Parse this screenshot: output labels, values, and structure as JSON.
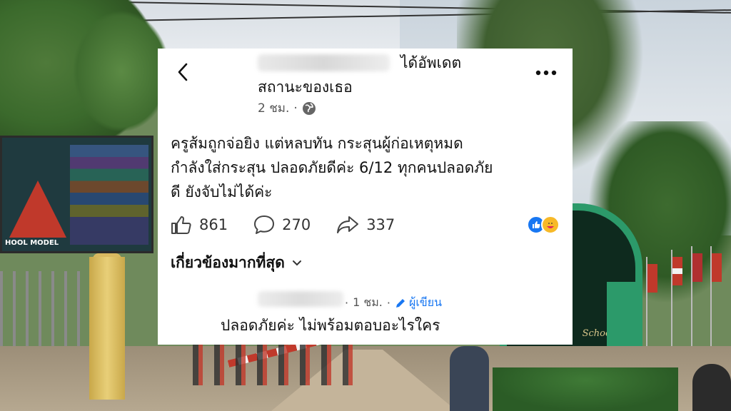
{
  "post": {
    "name_suffix": "ได้อัพเดต",
    "status_line": "สถานะของเธอ",
    "time": "2 ชม.",
    "dot": "·",
    "text": "ครูส้มถูกจ่อยิง  แต่หลบทัน กระสุนผู้ก่อเหตุหมด\nกำลังใส่กระสุน ปลอดภัยดีค่ะ 6/12 ทุกคนปลอดภัย\nดี  ยังจับไม่ได้ค่ะ",
    "likes": "861",
    "comments": "270",
    "shares": "337"
  },
  "sort": {
    "label": "เกี่ยวข้องมากที่สุด"
  },
  "comment": {
    "time": "1 ชม.",
    "dot": "·",
    "author_badge": "ผู้เขียน",
    "text": "ปลอดภัยค่ะ  ไม่พร้อมตอบอะไรใคร"
  },
  "background": {
    "school_word": "School",
    "billboard_caption": "HOOL MODEL"
  },
  "colors": {
    "facebook_blue": "#1877f2",
    "care_yellow": "#f7b928"
  },
  "icons": {
    "back": "chevron-left-icon",
    "more": "more-horizontal-icon",
    "audience": "globe-icon",
    "like": "thumbs-up-icon",
    "comment": "comment-bubble-icon",
    "share": "share-arrow-icon",
    "sort": "chevron-down-icon",
    "author": "pencil-icon"
  }
}
